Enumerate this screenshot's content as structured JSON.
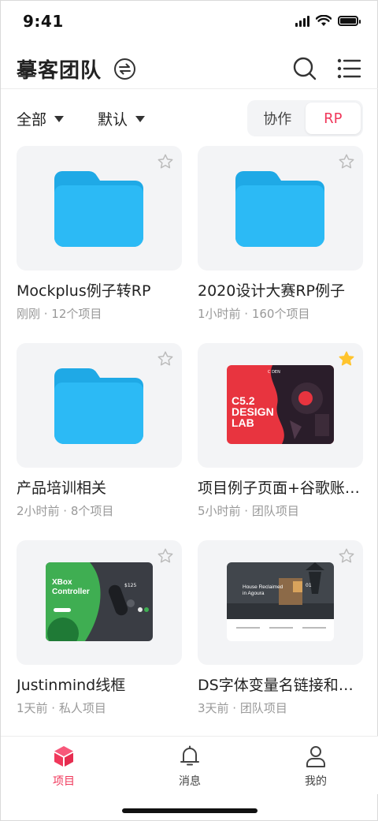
{
  "status": {
    "time": "9:41"
  },
  "header": {
    "title": "摹客团队"
  },
  "filters": {
    "scope": "全部",
    "sort": "默认"
  },
  "segment": {
    "options": [
      "协作",
      "RP"
    ],
    "active": 1
  },
  "projects": [
    {
      "title": "Mockplus例子转RP",
      "meta": "刚刚 · 12个项目",
      "thumb": "folder-icon",
      "starred": false
    },
    {
      "title": "2020设计大赛RP例子",
      "meta": "1小时前 · 160个项目",
      "thumb": "folder-icon",
      "starred": false
    },
    {
      "title": "产品培训相关",
      "meta": "2小时前 · 8个项目",
      "thumb": "folder-icon",
      "starred": false
    },
    {
      "title": "项目例子页面+谷歌账号登录",
      "meta": "5小时前 · 团队项目",
      "thumb": "design-lab-preview",
      "starred": true,
      "preview": {
        "brand": "C DEN",
        "line1": "C5.2",
        "line2": "DESIGN",
        "line3": "LAB"
      }
    },
    {
      "title": "Justinmind线框",
      "meta": "1天前 · 私人项目",
      "thumb": "xbox-preview",
      "starred": false,
      "preview": {
        "line1": "XBox",
        "line2": "Controller",
        "price": "$125"
      }
    },
    {
      "title": "DS字体变量名链接和交互",
      "meta": "3天前 · 团队项目",
      "thumb": "house-preview",
      "starred": false,
      "preview": {
        "line1": "House Reclaimed",
        "line2": "in Agoura",
        "num": "01"
      }
    }
  ],
  "tabs": [
    {
      "label": "项目",
      "icon": "cube-icon",
      "active": true
    },
    {
      "label": "消息",
      "icon": "bell-icon",
      "active": false
    },
    {
      "label": "我的",
      "icon": "user-icon",
      "active": false
    }
  ],
  "colors": {
    "accent": "#f0385b",
    "folder": "#2cbaf5",
    "star_active": "#ffc42e"
  }
}
